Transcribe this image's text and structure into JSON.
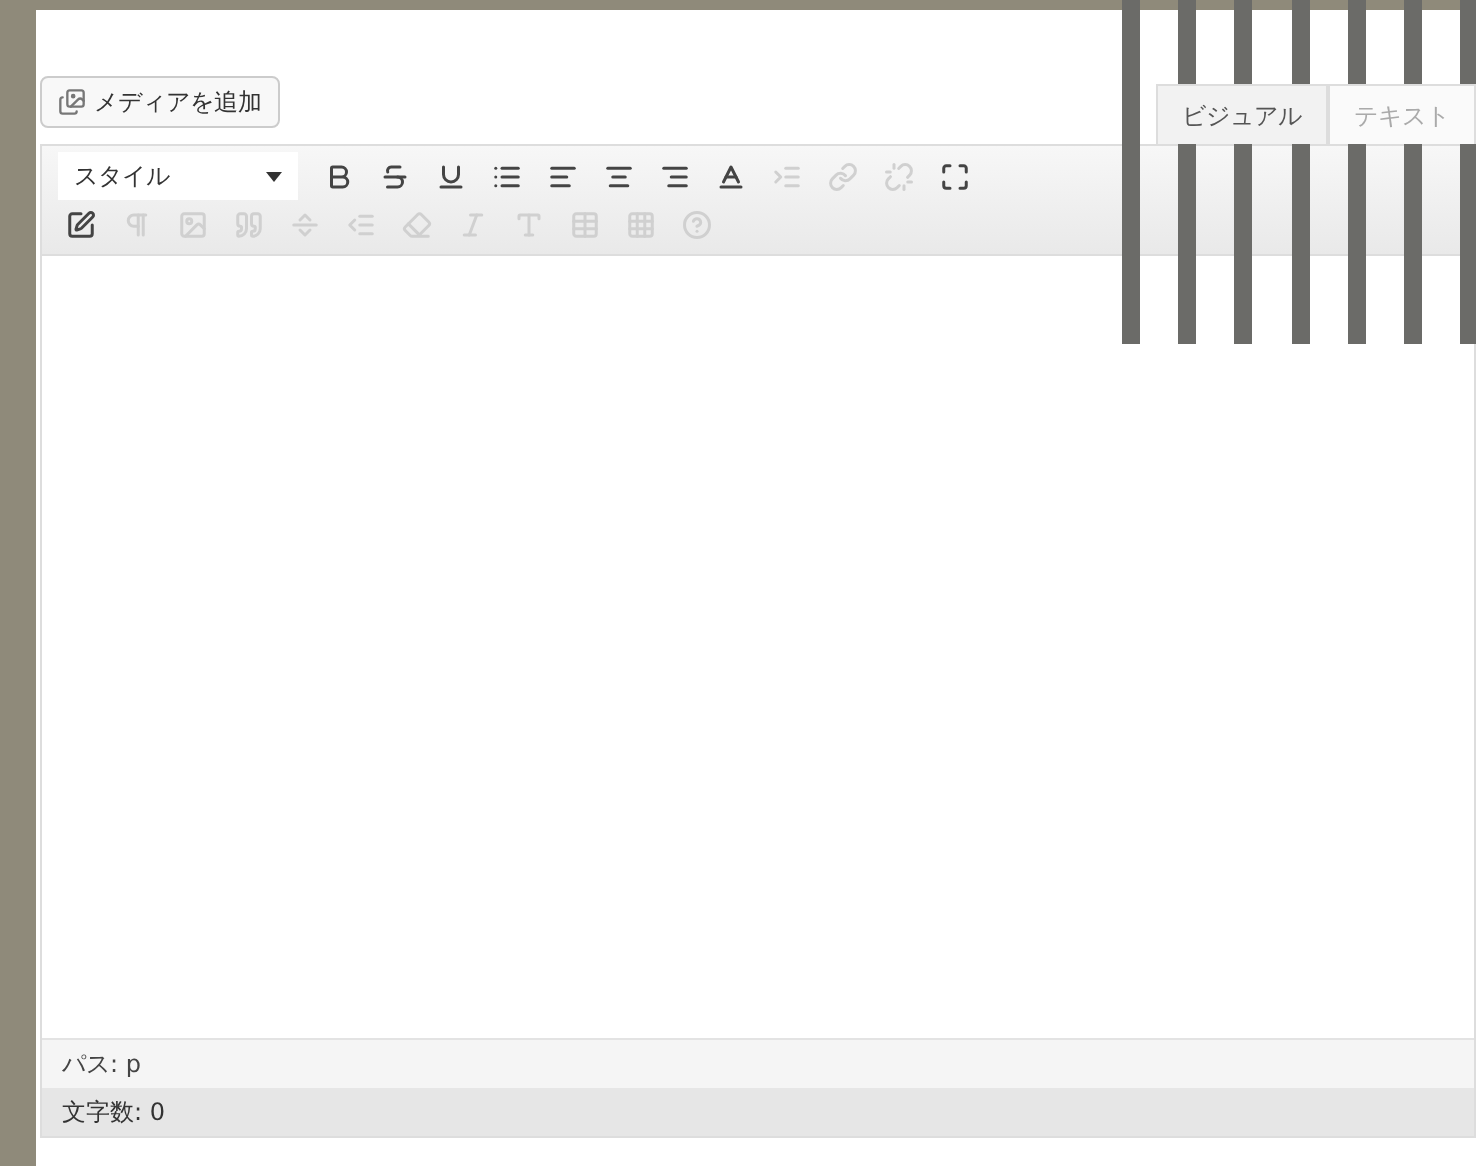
{
  "media_button": {
    "label": "メディアを追加"
  },
  "tabs": [
    {
      "label": "ビジュアル",
      "selected": true
    },
    {
      "label": "テキスト",
      "selected": false
    }
  ],
  "style_select": {
    "value": "スタイル"
  },
  "toolbar_row_1": [
    {
      "kind": "bold",
      "disabled": false
    },
    {
      "kind": "strikethrough",
      "disabled": false
    },
    {
      "kind": "underline",
      "disabled": false
    },
    {
      "kind": "list",
      "disabled": false
    },
    {
      "kind": "align-left",
      "disabled": false
    },
    {
      "kind": "align-center",
      "disabled": false
    },
    {
      "kind": "align-right",
      "disabled": false
    },
    {
      "kind": "text-color",
      "disabled": false
    },
    {
      "kind": "indent",
      "disabled": true
    },
    {
      "kind": "link",
      "disabled": true
    },
    {
      "kind": "unlink",
      "disabled": true
    },
    {
      "kind": "fullscreen",
      "disabled": false
    }
  ],
  "toolbar_row_2": [
    {
      "kind": "edit",
      "disabled": false
    },
    {
      "kind": "paragraph",
      "disabled": true
    },
    {
      "kind": "image",
      "disabled": true
    },
    {
      "kind": "quote",
      "disabled": true
    },
    {
      "kind": "separator",
      "disabled": true
    },
    {
      "kind": "outdent",
      "disabled": true
    },
    {
      "kind": "eraser",
      "disabled": true
    },
    {
      "kind": "italic",
      "disabled": true
    },
    {
      "kind": "type",
      "disabled": true
    },
    {
      "kind": "table",
      "disabled": true
    },
    {
      "kind": "grid",
      "disabled": true
    },
    {
      "kind": "help",
      "disabled": true
    }
  ],
  "status_bar": {
    "path": "パス: p",
    "word_count": "文字数: 0"
  }
}
